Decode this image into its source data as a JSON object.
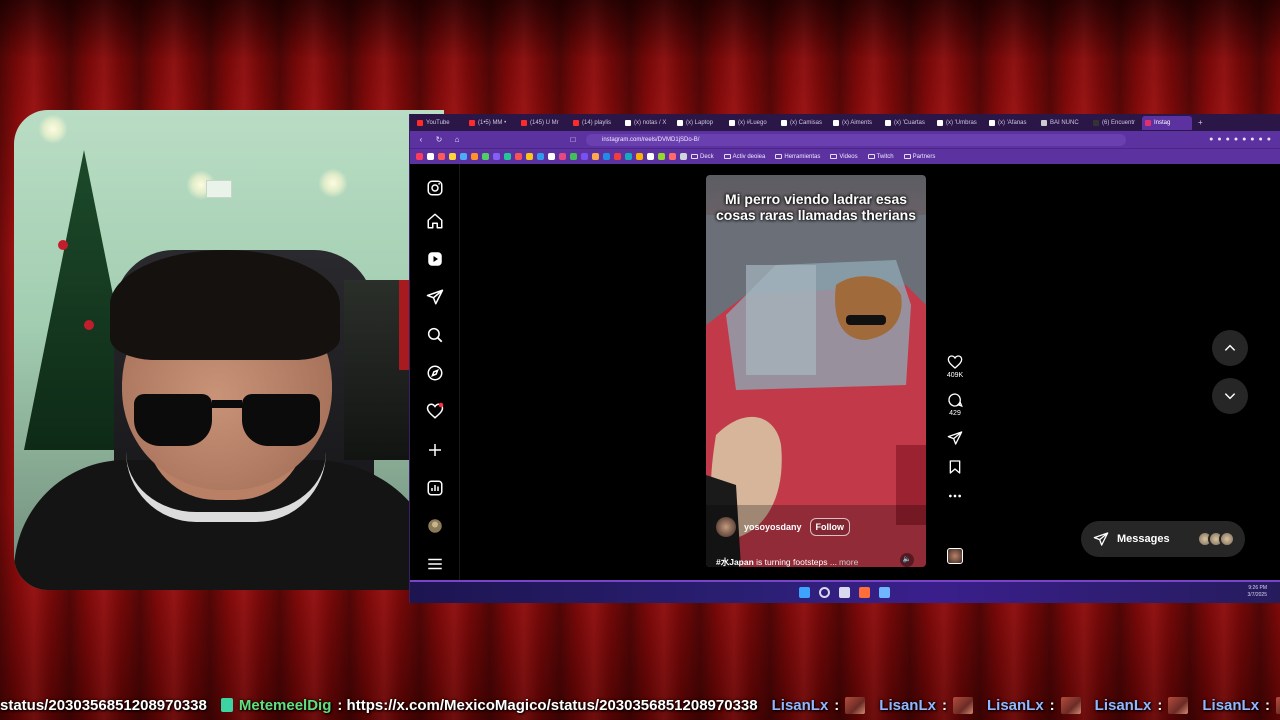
{
  "browser": {
    "tabs": [
      {
        "label": "YouTube",
        "color": "#ff2a2a"
      },
      {
        "label": "(1•5) MM •",
        "color": "#ff2a2a"
      },
      {
        "label": "(145) U Mr",
        "color": "#ff2a2a"
      },
      {
        "label": "(14) playlis",
        "color": "#ff2a2a"
      },
      {
        "label": "(x) notas / X",
        "color": "#ffffff"
      },
      {
        "label": "(x) Laptop",
        "color": "#ffffff"
      },
      {
        "label": "(x) #Luego",
        "color": "#ffffff"
      },
      {
        "label": "(x) Camisas",
        "color": "#ffffff"
      },
      {
        "label": "(x) Aiments",
        "color": "#ffffff"
      },
      {
        "label": "(x) 'Cuartas",
        "color": "#ffffff"
      },
      {
        "label": "(x) 'Umbras",
        "color": "#ffffff"
      },
      {
        "label": "(x) 'Afanas",
        "color": "#ffffff"
      },
      {
        "label": "BAI NUNC",
        "color": "#cccccc"
      },
      {
        "label": "(6) Encuentr",
        "color": "#333333"
      },
      {
        "label": "Instag",
        "color": "#e1306c"
      }
    ],
    "active_tab_index": 14,
    "url": "instagram.com/reels/DVMD1jSDo-B/",
    "bookmarks": [
      {
        "label": "Deck"
      },
      {
        "label": "Activ deoiea"
      },
      {
        "label": "Herramientas"
      },
      {
        "label": "Videos"
      },
      {
        "label": "Twitch"
      },
      {
        "label": "Partners"
      }
    ]
  },
  "instagram": {
    "sidebar": [
      "instagram-logo-icon",
      "home-icon",
      "reels-icon",
      "direct-icon",
      "search-icon",
      "explore-icon",
      "heart-icon",
      "create-icon",
      "insights-icon",
      "profile-avatar",
      "menu-icon"
    ],
    "reel": {
      "caption": "Mi perro viendo ladrar esas cosas raras llamadas therians",
      "username": "yosoyosdany",
      "follow_label": "Follow",
      "description_tag": "#水Japan",
      "description_text": " is turning footsteps ...",
      "more_label": "more"
    },
    "actions": {
      "likes": "409K",
      "comments": "429"
    },
    "messages_label": "Messages"
  },
  "taskbar": {
    "time": "9:26 PM",
    "date": "3/7/2025"
  },
  "ticker": {
    "segment1_text": "status/2030356851208970338",
    "segment2_user": "MetemeelDig",
    "segment2_text": ": https://x.com/MexicoMagico/status/2030356851208970338",
    "repeat_user": "LisanLx",
    "repeat_sep": ":"
  },
  "colors": {
    "browser_accent": "#5b32a0",
    "curtain": "#a40f0f",
    "ticker_user_green": "#5fe07c",
    "ticker_user_blue": "#93b7ff"
  }
}
